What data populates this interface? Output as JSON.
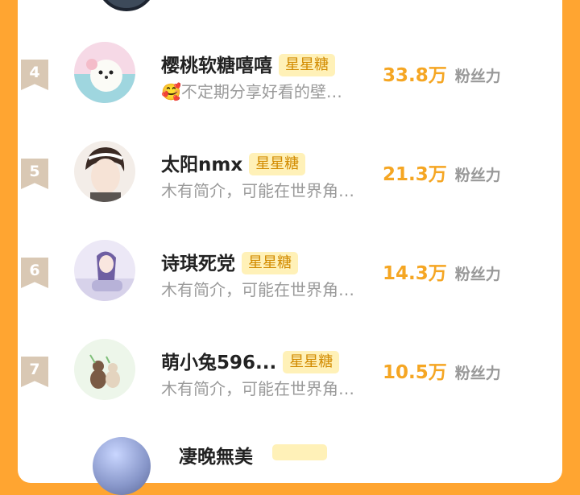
{
  "rows": [
    {
      "rank": "4",
      "name": "樱桃软糖嘻嘻",
      "tag": "星星糖",
      "emoji": "🥰",
      "desc": "不定期分享好看的壁…",
      "count": "33.8万",
      "unit": "粉丝力"
    },
    {
      "rank": "5",
      "name": "太阳nmx",
      "tag": "星星糖",
      "emoji": "",
      "desc": "木有简介，可能在世界角…",
      "count": "21.3万",
      "unit": "粉丝力"
    },
    {
      "rank": "6",
      "name": "诗琪死党",
      "tag": "星星糖",
      "emoji": "",
      "desc": "木有简介，可能在世界角…",
      "count": "14.3万",
      "unit": "粉丝力"
    },
    {
      "rank": "7",
      "name": "萌小兔596...",
      "tag": "星星糖",
      "emoji": "",
      "desc": "木有简介，可能在世界角…",
      "count": "10.5万",
      "unit": "粉丝力"
    }
  ],
  "peek": {
    "name": "凄晚無美"
  },
  "colors": {
    "background": "#ffa531",
    "panel": "#ffffff",
    "count": "#f5a623",
    "tag_bg": "#fff1b8",
    "tag_text": "#d28b00"
  }
}
